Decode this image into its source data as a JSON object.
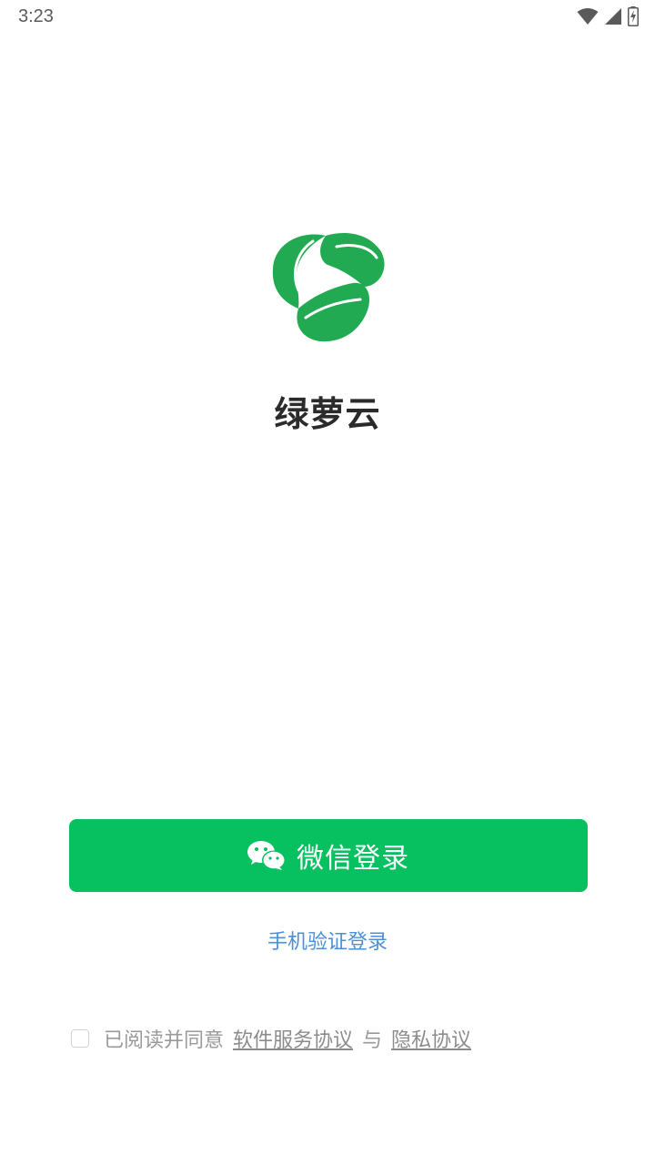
{
  "status_bar": {
    "time": "3:23",
    "icons": [
      "wifi-icon",
      "cellular-signal-icon",
      "battery-charging-icon"
    ]
  },
  "app": {
    "name": "绿萝云",
    "logo_icon": "green-leaf-logo-icon",
    "brand_color": "#22aa52"
  },
  "login": {
    "wechat_label": "微信登录",
    "wechat_icon": "wechat-icon",
    "wechat_button_color": "#07c160",
    "phone_label": "手机验证登录",
    "phone_link_color": "#4a8fd8"
  },
  "agreement": {
    "checked": false,
    "prefix": "已阅读并同意",
    "service_terms": "软件服务协议",
    "conjunction": "与",
    "privacy_policy": "隐私协议"
  }
}
